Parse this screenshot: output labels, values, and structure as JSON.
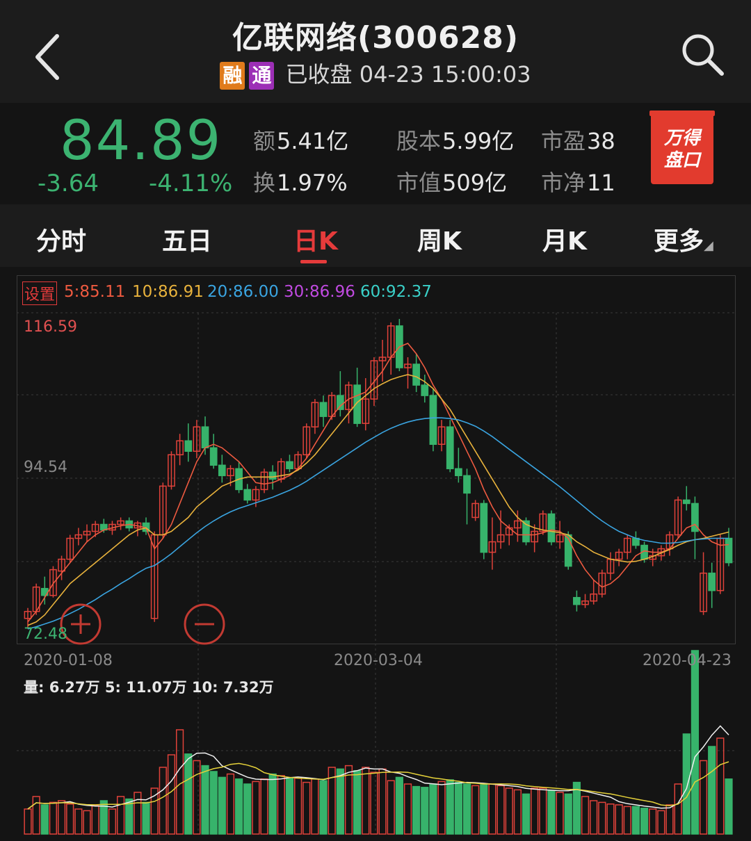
{
  "header": {
    "title": "亿联网络(300628)",
    "tag_rong": "融",
    "tag_tong": "通",
    "status": "已收盘 04-23 15:00:03"
  },
  "quote": {
    "price": "84.89",
    "change": "-3.64",
    "change_pct": "-4.11%",
    "stats": [
      {
        "k": "额",
        "v": "5.41亿"
      },
      {
        "k": "换",
        "v": "1.97%"
      },
      {
        "k": "股本",
        "v": "5.99亿"
      },
      {
        "k": "市值",
        "v": "509亿"
      },
      {
        "k": "市盈",
        "v": "38"
      },
      {
        "k": "市净",
        "v": "11"
      }
    ],
    "wind_button": [
      "万得",
      "盘口"
    ]
  },
  "tabs": [
    "分时",
    "五日",
    "日K",
    "周K",
    "月K",
    "更多"
  ],
  "active_tab": "日K",
  "ma_legend": {
    "settings": "设置",
    "items": [
      {
        "label": "5:85.11",
        "color": "#ee5a40"
      },
      {
        "label": "10:86.91",
        "color": "#e8b23c"
      },
      {
        "label": "20:86.00",
        "color": "#3aa4e0"
      },
      {
        "label": "30:86.96",
        "color": "#c04ae0"
      },
      {
        "label": "60:92.37",
        "color": "#3ad0c8"
      }
    ]
  },
  "chart_data": {
    "type": "candlestick",
    "y_labels": {
      "high": "116.59",
      "mid": "94.54",
      "low": "72.48"
    },
    "x_labels": [
      "2020-01-08",
      "2020-03-04",
      "2020-04-23"
    ],
    "candles": [
      [
        74.5,
        76.0,
        73.0,
        75.5
      ],
      [
        75.5,
        79.5,
        75.0,
        79.0
      ],
      [
        78.8,
        80.5,
        76.5,
        77.8
      ],
      [
        77.8,
        82.0,
        77.5,
        81.5
      ],
      [
        81.3,
        83.5,
        80.0,
        83.0
      ],
      [
        83.0,
        86.5,
        82.5,
        86.0
      ],
      [
        86.0,
        87.5,
        85.0,
        86.5
      ],
      [
        86.5,
        88.0,
        85.5,
        87.0
      ],
      [
        87.0,
        88.5,
        86.2,
        88.0
      ],
      [
        88.0,
        88.8,
        86.8,
        87.2
      ],
      [
        87.2,
        88.5,
        86.5,
        88.0
      ],
      [
        88.0,
        89.0,
        87.2,
        88.5
      ],
      [
        88.5,
        89.0,
        87.0,
        87.5
      ],
      [
        87.5,
        88.5,
        86.3,
        88.2
      ],
      [
        88.2,
        89.0,
        86.5,
        87.0
      ],
      [
        74.5,
        87.0,
        74.0,
        86.5
      ],
      [
        86.5,
        94.0,
        86.0,
        93.5
      ],
      [
        93.5,
        98.5,
        93.0,
        98.0
      ],
      [
        98.0,
        101.0,
        96.5,
        100.0
      ],
      [
        100.0,
        102.5,
        97.0,
        98.5
      ],
      [
        98.5,
        103.0,
        97.5,
        102.0
      ],
      [
        102.0,
        103.5,
        98.0,
        99.0
      ],
      [
        99.0,
        101.0,
        96.0,
        96.5
      ],
      [
        96.5,
        98.0,
        94.0,
        95.0
      ],
      [
        95.0,
        96.5,
        93.5,
        96.0
      ],
      [
        96.0,
        97.0,
        92.5,
        93.0
      ],
      [
        93.0,
        93.8,
        91.0,
        91.5
      ],
      [
        91.5,
        93.5,
        90.5,
        93.0
      ],
      [
        93.0,
        96.0,
        92.5,
        95.5
      ],
      [
        95.5,
        96.5,
        93.0,
        94.5
      ],
      [
        94.5,
        97.5,
        94.0,
        97.0
      ],
      [
        97.0,
        98.0,
        95.5,
        96.0
      ],
      [
        96.0,
        98.5,
        95.8,
        98.0
      ],
      [
        98.0,
        102.5,
        97.5,
        102.0
      ],
      [
        102.0,
        106.0,
        101.0,
        105.5
      ],
      [
        105.5,
        106.5,
        102.0,
        103.5
      ],
      [
        103.5,
        107.0,
        103.0,
        106.5
      ],
      [
        106.5,
        110.0,
        103.5,
        104.5
      ],
      [
        104.5,
        108.5,
        102.5,
        108.0
      ],
      [
        108.0,
        110.5,
        102.0,
        102.5
      ],
      [
        102.5,
        109.0,
        101.5,
        106.0
      ],
      [
        106.0,
        112.0,
        105.0,
        111.5
      ],
      [
        111.5,
        114.5,
        108.5,
        112.0
      ],
      [
        112.0,
        117.0,
        109.5,
        116.5
      ],
      [
        116.5,
        117.5,
        110.0,
        110.5
      ],
      [
        110.5,
        112.0,
        107.5,
        111.0
      ],
      [
        111.0,
        112.5,
        107.0,
        108.0
      ],
      [
        108.0,
        109.5,
        105.5,
        106.5
      ],
      [
        106.5,
        107.5,
        98.5,
        99.5
      ],
      [
        99.5,
        103.0,
        98.5,
        102.0
      ],
      [
        102.0,
        103.0,
        95.5,
        96.0
      ],
      [
        96.0,
        99.0,
        94.0,
        95.0
      ],
      [
        95.0,
        96.0,
        88.0,
        92.5
      ],
      [
        89.0,
        91.5,
        88.5,
        91.0
      ],
      [
        91.0,
        91.5,
        83.0,
        84.0
      ],
      [
        84.0,
        89.0,
        81.5,
        85.5
      ],
      [
        85.5,
        90.0,
        84.5,
        86.5
      ],
      [
        86.5,
        88.0,
        85.0,
        87.5
      ],
      [
        87.5,
        90.0,
        85.5,
        88.5
      ],
      [
        88.5,
        89.0,
        85.0,
        85.5
      ],
      [
        85.5,
        88.0,
        84.0,
        87.0
      ],
      [
        87.0,
        90.0,
        86.5,
        89.5
      ],
      [
        89.5,
        90.0,
        85.0,
        85.5
      ],
      [
        85.5,
        88.5,
        84.5,
        86.5
      ],
      [
        86.5,
        87.0,
        81.5,
        82.0
      ],
      [
        77.5,
        78.5,
        75.5,
        76.5
      ],
      [
        76.5,
        78.0,
        76.0,
        77.0
      ],
      [
        77.0,
        80.0,
        76.5,
        78.0
      ],
      [
        78.0,
        81.5,
        77.5,
        81.0
      ],
      [
        81.0,
        84.0,
        80.0,
        83.0
      ],
      [
        83.0,
        84.5,
        82.0,
        84.0
      ],
      [
        84.0,
        86.5,
        83.0,
        86.0
      ],
      [
        86.0,
        87.0,
        84.5,
        85.0
      ],
      [
        85.0,
        85.5,
        82.5,
        83.0
      ],
      [
        83.0,
        84.5,
        82.0,
        83.5
      ],
      [
        83.5,
        85.0,
        82.8,
        84.5
      ],
      [
        84.5,
        87.0,
        83.5,
        86.5
      ],
      [
        86.5,
        92.0,
        86.0,
        91.5
      ],
      [
        91.5,
        93.5,
        90.0,
        91.0
      ],
      [
        91.0,
        92.0,
        83.0,
        87.0
      ],
      [
        75.5,
        84.0,
        75.0,
        81.0
      ],
      [
        81.0,
        82.5,
        76.0,
        78.5
      ],
      [
        78.5,
        86.5,
        78.0,
        86.0
      ],
      [
        86.0,
        87.5,
        82.0,
        82.5
      ]
    ],
    "ma_series": {
      "ma5": [
        74.0,
        75.5,
        77.5,
        79.5,
        81.0,
        82.5,
        84.0,
        85.5,
        86.5,
        87.2,
        87.5,
        87.8,
        88.0,
        87.8,
        87.5,
        84.5,
        86.0,
        88.0,
        91.0,
        94.0,
        97.0,
        99.0,
        99.5,
        99.0,
        98.0,
        97.0,
        95.5,
        94.0,
        93.8,
        94.0,
        94.5,
        95.0,
        96.0,
        97.5,
        99.5,
        101.5,
        103.5,
        105.0,
        106.0,
        106.5,
        107.0,
        108.5,
        110.0,
        112.0,
        113.5,
        114.0,
        112.5,
        110.5,
        108.0,
        106.0,
        103.5,
        101.0,
        98.5,
        96.0,
        93.0,
        90.5,
        88.5,
        87.5,
        86.5,
        86.5,
        86.5,
        86.8,
        87.2,
        87.0,
        86.0,
        83.5,
        81.5,
        80.0,
        79.0,
        79.5,
        80.5,
        82.0,
        83.5,
        84.2,
        84.0,
        84.0,
        84.5,
        86.0,
        87.5,
        88.0,
        86.5,
        85.5,
        85.0,
        85.1
      ],
      "ma10": [
        73.5,
        74.0,
        75.0,
        76.5,
        78.0,
        79.5,
        80.5,
        81.5,
        82.5,
        83.5,
        84.5,
        85.5,
        86.5,
        87.2,
        87.5,
        86.5,
        86.5,
        87.0,
        88.0,
        89.0,
        90.5,
        91.5,
        92.5,
        93.5,
        94.0,
        94.5,
        94.8,
        94.8,
        94.8,
        94.8,
        95.0,
        95.2,
        95.8,
        96.8,
        98.0,
        99.5,
        101.0,
        102.5,
        104.0,
        105.5,
        106.5,
        107.5,
        108.2,
        108.8,
        109.2,
        109.5,
        109.2,
        108.5,
        107.5,
        106.0,
        104.5,
        102.5,
        100.5,
        98.5,
        96.5,
        94.5,
        92.5,
        90.5,
        89.0,
        88.0,
        87.5,
        87.2,
        87.0,
        86.8,
        86.5,
        85.5,
        84.8,
        84.0,
        83.5,
        83.0,
        82.8,
        82.6,
        82.7,
        83.0,
        83.4,
        83.9,
        84.4,
        85.0,
        85.5,
        85.8,
        86.0,
        86.3,
        86.6,
        86.9
      ],
      "ma20": [
        73.0,
        73.3,
        73.7,
        74.1,
        74.6,
        75.2,
        75.8,
        76.5,
        77.2,
        78.0,
        78.7,
        79.5,
        80.2,
        81.0,
        81.7,
        82.1,
        82.9,
        83.8,
        84.8,
        85.8,
        86.8,
        87.7,
        88.5,
        89.2,
        89.8,
        90.3,
        90.7,
        91.1,
        91.5,
        91.9,
        92.4,
        92.9,
        93.5,
        94.2,
        95.0,
        95.8,
        96.6,
        97.4,
        98.2,
        99.0,
        99.8,
        100.5,
        101.2,
        101.8,
        102.3,
        102.7,
        103.0,
        103.2,
        103.3,
        103.3,
        103.2,
        103.0,
        102.6,
        102.1,
        101.4,
        100.6,
        99.7,
        98.8,
        97.9,
        97.0,
        96.1,
        95.2,
        94.3,
        93.4,
        92.4,
        91.4,
        90.4,
        89.4,
        88.5,
        87.7,
        87.0,
        86.5,
        86.0,
        85.7,
        85.5,
        85.3,
        85.3,
        85.4,
        85.6,
        85.8,
        85.9,
        86.0,
        86.0,
        86.0
      ]
    },
    "volume": {
      "label": "量: 6.27万  5: 11.07万  10: 7.32万",
      "bars_rel": [
        0.3,
        0.45,
        0.35,
        0.38,
        0.4,
        0.36,
        0.3,
        0.28,
        0.34,
        0.4,
        0.3,
        0.45,
        0.42,
        0.5,
        0.38,
        0.55,
        0.8,
        0.95,
        1.25,
        0.96,
        0.88,
        0.82,
        0.75,
        0.68,
        0.72,
        0.66,
        0.6,
        0.63,
        0.66,
        0.72,
        0.7,
        0.67,
        0.67,
        0.62,
        0.66,
        0.64,
        0.8,
        0.78,
        0.82,
        0.76,
        0.8,
        0.74,
        0.78,
        0.64,
        0.68,
        0.6,
        0.57,
        0.56,
        0.6,
        0.63,
        0.65,
        0.62,
        0.6,
        0.58,
        0.59,
        0.6,
        0.58,
        0.55,
        0.53,
        0.48,
        0.55,
        0.55,
        0.52,
        0.5,
        0.48,
        0.62,
        0.45,
        0.4,
        0.38,
        0.36,
        0.35,
        0.33,
        0.33,
        0.31,
        0.3,
        0.28,
        0.35,
        0.6,
        1.2,
        2.2,
        0.88,
        1.05,
        1.15,
        0.66
      ],
      "bars_up": [
        1,
        1,
        0,
        1,
        1,
        1,
        1,
        1,
        1,
        0,
        1,
        1,
        0,
        1,
        0,
        1,
        1,
        1,
        1,
        0,
        1,
        0,
        0,
        0,
        1,
        0,
        0,
        1,
        1,
        0,
        1,
        0,
        1,
        1,
        1,
        0,
        1,
        0,
        1,
        0,
        1,
        1,
        1,
        1,
        0,
        1,
        0,
        0,
        0,
        1,
        0,
        0,
        0,
        1,
        0,
        1,
        1,
        1,
        1,
        0,
        1,
        1,
        0,
        1,
        0,
        0,
        1,
        1,
        1,
        1,
        1,
        1,
        0,
        0,
        1,
        1,
        1,
        1,
        0,
        0,
        1,
        0,
        1,
        0
      ]
    }
  }
}
